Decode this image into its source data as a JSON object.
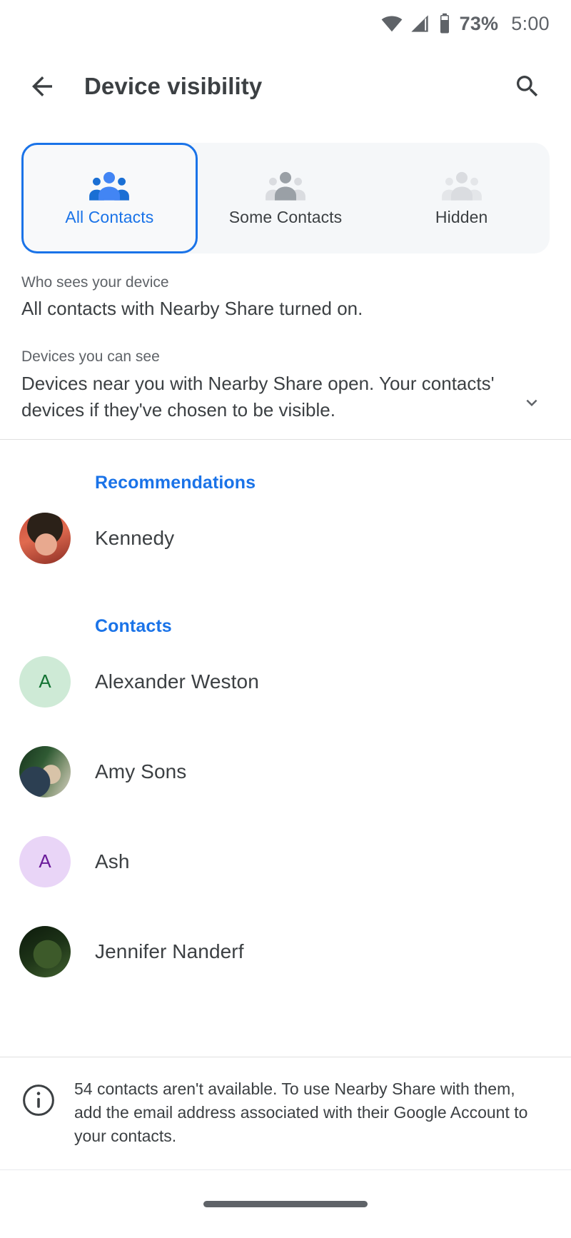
{
  "statusbar": {
    "wifi_icon": "wifi-icon",
    "signal_icon": "cell-signal-icon",
    "battery_icon": "battery-icon",
    "battery_percent": "73%",
    "time": "5:00"
  },
  "appbar": {
    "back_icon": "back-arrow-icon",
    "title": "Device visibility",
    "search_icon": "search-icon"
  },
  "tabs": {
    "selected_index": 0,
    "items": [
      {
        "label": "All Contacts",
        "icon": "group-people-icon",
        "state": "selected"
      },
      {
        "label": "Some Contacts",
        "icon": "group-people-icon",
        "state": "normal"
      },
      {
        "label": "Hidden",
        "icon": "group-people-icon",
        "state": "dimmed"
      }
    ]
  },
  "description": {
    "who_sees_label": "Who sees your device",
    "who_sees_value": "All contacts with Nearby Share turned on.",
    "devices_label": "Devices you can see",
    "devices_value": "Devices near you with Nearby Share open. Your contacts' devices if they've chosen to be visible.",
    "expand_icon": "chevron-down-icon"
  },
  "sections": [
    {
      "title": "Recommendations",
      "rows": [
        {
          "name": "Kennedy",
          "avatar_type": "photo",
          "avatar_class": "ph-kennedy",
          "initial": ""
        }
      ]
    },
    {
      "title": "Contacts",
      "rows": [
        {
          "name": "Alexander Weston",
          "avatar_type": "initial",
          "initial": "A",
          "avatar_bg": "#ceead6",
          "avatar_fg": "#137333"
        },
        {
          "name": "Amy Sons",
          "avatar_type": "photo",
          "avatar_class": "ph-amy",
          "initial": ""
        },
        {
          "name": "Ash",
          "avatar_type": "initial",
          "initial": "A",
          "avatar_bg": "#e9d5f7",
          "avatar_fg": "#6a1b9a"
        },
        {
          "name": "Jennifer Nanderf",
          "avatar_type": "photo",
          "avatar_class": "ph-jennifer",
          "initial": ""
        }
      ]
    }
  ],
  "banner": {
    "info_icon": "info-icon",
    "text": "54 contacts aren't available. To use Nearby Share with them, add the email address associated with their Google Account to your contacts."
  },
  "navbar": {
    "handle": "home-gesture-handle"
  },
  "colors": {
    "accent": "#1a73e8",
    "text_primary": "#3c4043",
    "text_secondary": "#5f6368",
    "tab_track": "#f5f7f9",
    "divider": "#e0e0e0"
  }
}
